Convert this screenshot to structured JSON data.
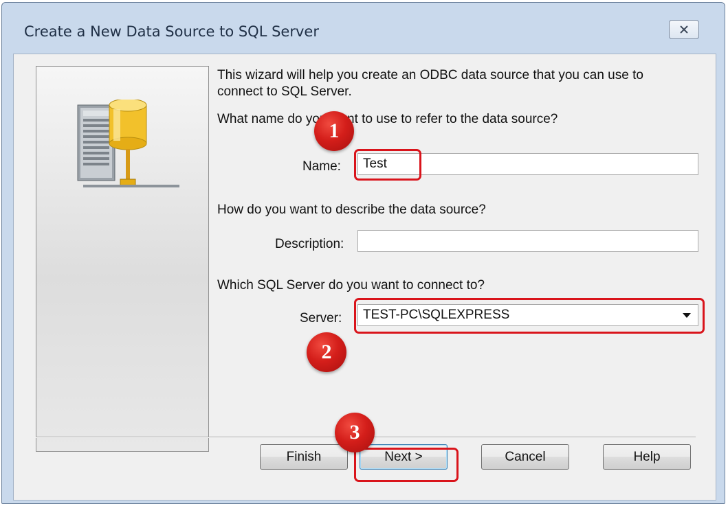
{
  "window": {
    "title": "Create a New Data Source to SQL Server",
    "close_icon": "close-icon"
  },
  "wizard": {
    "intro_text_line1": "This wizard will help you create an ODBC data source that you can use to",
    "intro_text_line2": "connect to SQL Server.",
    "name_question": "What name do you want to use to refer to the data source?",
    "name_label": "Name:",
    "name_value": "Test",
    "description_question": "How do you want to describe the data source?",
    "description_label": "Description:",
    "description_value": "",
    "server_question": "Which SQL Server do you want to connect to?",
    "server_label": "Server:",
    "server_value": "TEST-PC\\SQLEXPRESS",
    "side_icon": "database-server-icon"
  },
  "buttons": {
    "finish": "Finish",
    "next": "Next >",
    "cancel": "Cancel",
    "help": "Help"
  },
  "annotations": {
    "marker_1": "1",
    "marker_2": "2",
    "marker_3": "3",
    "color": "#d9141b"
  }
}
